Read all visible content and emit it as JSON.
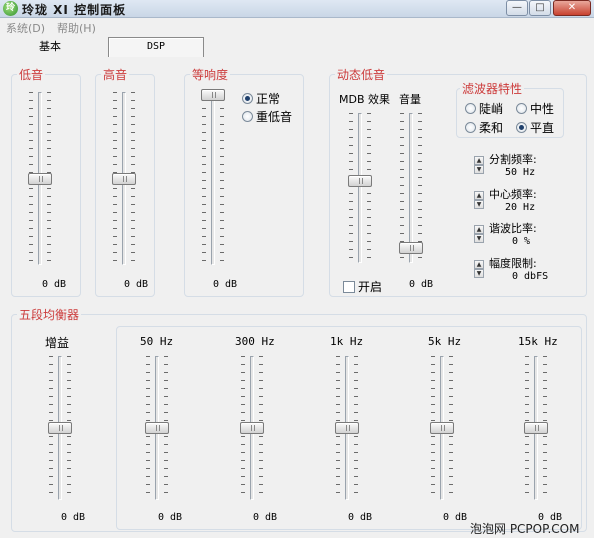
{
  "window": {
    "title": "玲珑 XI 控制面板",
    "minimize_glyph": "—",
    "maximize_glyph": "□",
    "close_glyph": "✕"
  },
  "menu": {
    "system": "系统(D)",
    "help": "帮助(H)"
  },
  "tabs": {
    "basic": "基本",
    "dsp": "DSP"
  },
  "bass": {
    "label": "低音",
    "db": "0 dB",
    "level": 0.5
  },
  "treble": {
    "label": "高音",
    "db": "0 dB",
    "level": 0.5
  },
  "loudness": {
    "label": "等响度",
    "db": "0 dB",
    "level": 0.98,
    "options": [
      {
        "label": "正常",
        "checked": true
      },
      {
        "label": "重低音",
        "checked": false
      }
    ]
  },
  "dynamic_bass": {
    "label": "动态低音",
    "mdb_label": "MDB 效果",
    "volume_label": "音量",
    "mdb_level": 0.55,
    "volume_level": 0.1,
    "enable_label": "开启",
    "volume_db": "0 dB",
    "filter": {
      "label": "滤波器特性",
      "options": [
        {
          "label": "陡峭",
          "checked": false
        },
        {
          "label": "中性",
          "checked": false
        },
        {
          "label": "柔和",
          "checked": false
        },
        {
          "label": "平直",
          "checked": true
        }
      ]
    },
    "params": {
      "crossover_label": "分割频率:",
      "crossover_value": "50 Hz",
      "center_label": "中心频率:",
      "center_value": "20 Hz",
      "harmonic_label": "谐波比率:",
      "harmonic_value": "0 %",
      "limit_label": "幅度限制:",
      "limit_value": "0 dbFS"
    }
  },
  "equalizer": {
    "label": "五段均衡器",
    "gain_label": "增益",
    "gain_db": "0 dB",
    "gain_level": 0.5,
    "bands": [
      {
        "freq": "50 Hz",
        "db": "0 dB",
        "level": 0.5
      },
      {
        "freq": "300 Hz",
        "db": "0 dB",
        "level": 0.5
      },
      {
        "freq": "1k Hz",
        "db": "0 dB",
        "level": 0.5
      },
      {
        "freq": "5k Hz",
        "db": "0 dB",
        "level": 0.5
      },
      {
        "freq": "15k Hz",
        "db": "0 dB",
        "level": 0.5
      }
    ]
  },
  "watermark": "泡泡网 PCPOP.COM",
  "colors": {
    "group_label": "#cc3b3b",
    "background": "#f0f0f0"
  }
}
